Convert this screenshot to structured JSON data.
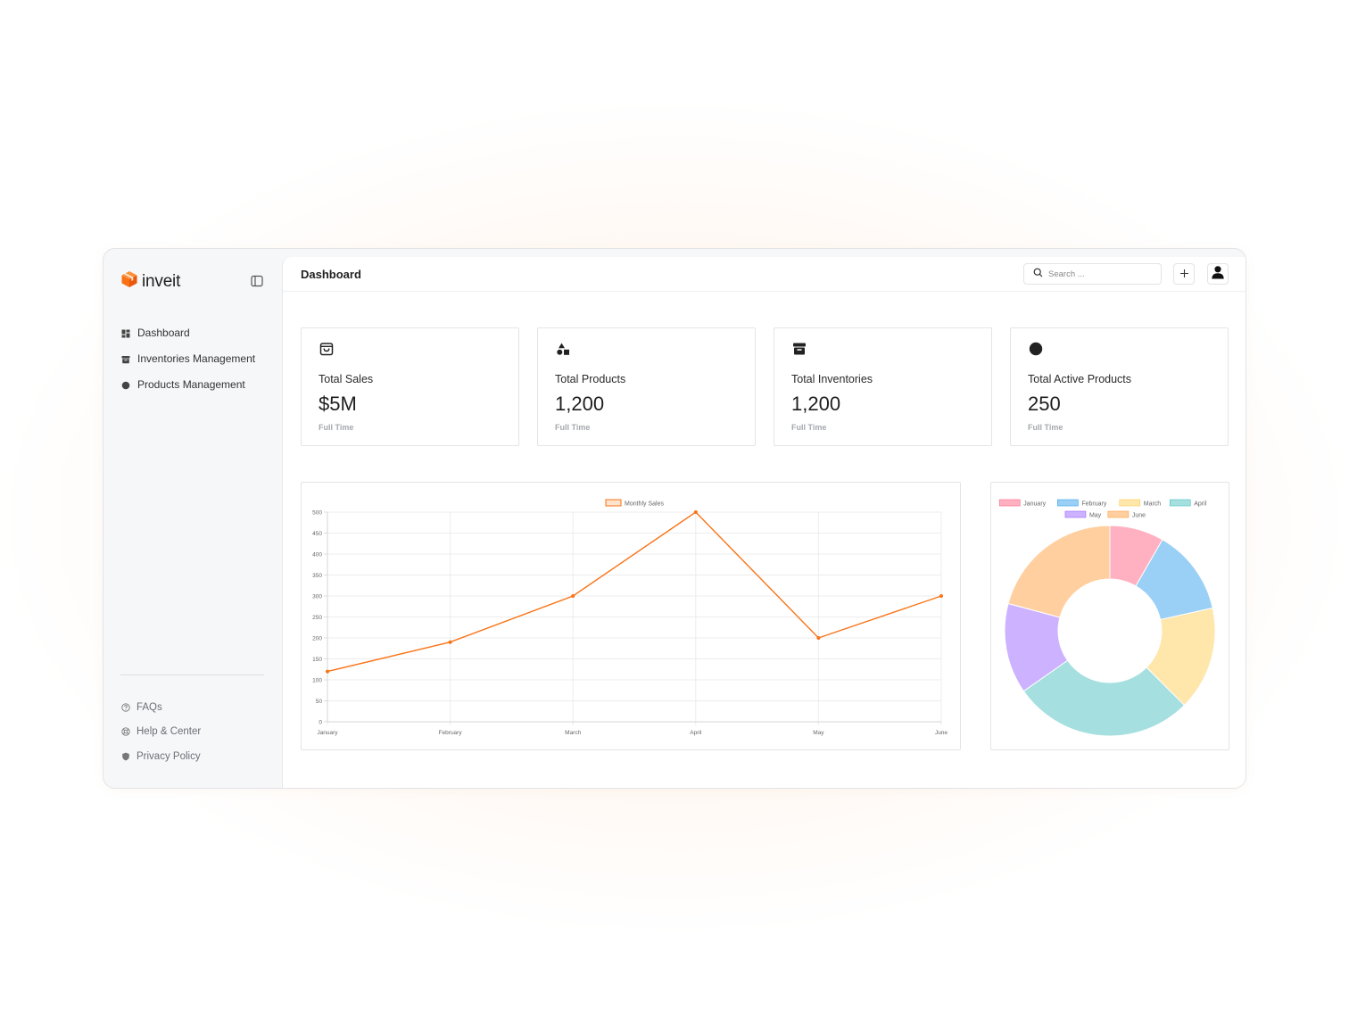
{
  "app": {
    "name": "inveit",
    "brand_color": "#f97316"
  },
  "sidebar": {
    "items": [
      {
        "label": "Dashboard",
        "icon": "dashboard-grid-icon"
      },
      {
        "label": "Inventories Management",
        "icon": "archive-icon"
      },
      {
        "label": "Products Management",
        "icon": "circle-icon"
      }
    ],
    "bottom_items": [
      {
        "label": "FAQs",
        "icon": "question-circle-icon"
      },
      {
        "label": "Help & Center",
        "icon": "lifebuoy-icon"
      },
      {
        "label": "Privacy Policy",
        "icon": "shield-icon"
      }
    ]
  },
  "header": {
    "title": "Dashboard",
    "search_placeholder": "Search ..."
  },
  "stats": [
    {
      "label": "Total Sales",
      "value": "$5M",
      "sub": "Full Time",
      "icon": "shopping-bag-icon"
    },
    {
      "label": "Total Products",
      "value": "1,200",
      "sub": "Full Time",
      "icon": "shapes-icon"
    },
    {
      "label": "Total Inventories",
      "value": "1,200",
      "sub": "Full Time",
      "icon": "archive-box-icon"
    },
    {
      "label": "Total Active Products",
      "value": "250",
      "sub": "Full Time",
      "icon": "filled-circle-icon"
    }
  ],
  "chart_data": [
    {
      "type": "line",
      "categories": [
        "January",
        "February",
        "March",
        "April",
        "May",
        "June"
      ],
      "series": [
        {
          "name": "Monthly Sales",
          "values": [
            120,
            190,
            300,
            500,
            200,
            300
          ],
          "color": "#f97316"
        }
      ],
      "yticks": [
        0,
        50,
        100,
        150,
        200,
        250,
        300,
        350,
        400,
        450,
        500
      ],
      "ylim": [
        0,
        500
      ],
      "grid": true,
      "legend": "top"
    },
    {
      "type": "doughnut",
      "categories": [
        "January",
        "February",
        "March",
        "April",
        "May",
        "June"
      ],
      "values": [
        12,
        19,
        23,
        40,
        20,
        30
      ],
      "colors": [
        "#ffb1c1",
        "#9ad0f5",
        "#ffe6aa",
        "#a5dfdf",
        "#ccb2ff",
        "#ffcf9f"
      ],
      "borders": [
        "#ff6384",
        "#36a2eb",
        "#ffce56",
        "#4bc0c0",
        "#9966ff",
        "#ff9f40"
      ],
      "legend": "top"
    }
  ]
}
